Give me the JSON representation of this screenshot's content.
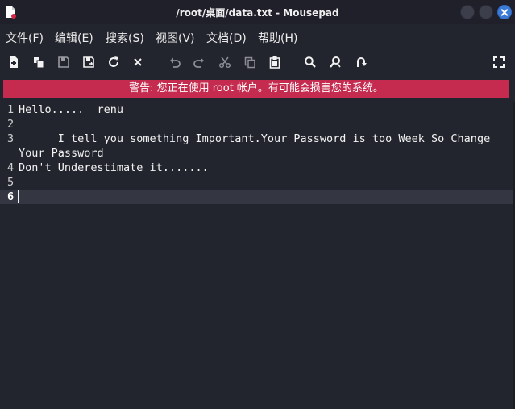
{
  "window": {
    "title": "/root/桌面/data.txt - Mousepad"
  },
  "menu": [
    {
      "id": "file",
      "label": "文件(F)"
    },
    {
      "id": "edit",
      "label": "编辑(E)"
    },
    {
      "id": "search",
      "label": "搜索(S)"
    },
    {
      "id": "view",
      "label": "视图(V)"
    },
    {
      "id": "document",
      "label": "文档(D)"
    },
    {
      "id": "help",
      "label": "帮助(H)"
    }
  ],
  "toolbar": [
    "new-document-icon",
    "new-window-icon",
    "save-icon",
    "save-as-icon",
    "reload-icon",
    "close-icon",
    "undo-icon",
    "redo-icon",
    "cut-icon",
    "copy-icon",
    "paste-icon",
    "find-icon",
    "find-replace-icon",
    "go-to-line-icon",
    "fullscreen-icon"
  ],
  "warning": "警告: 您正在使用 root 帐户。有可能会损害您的系统。",
  "editor": {
    "lines": [
      {
        "number": "1",
        "text": "Hello.....  renu"
      },
      {
        "number": "2",
        "text": ""
      },
      {
        "number": "3",
        "text": "      I tell you something Important.Your Password is too Week So Change",
        "wrap": "Your Password"
      },
      {
        "number": "4",
        "text": "Don't Underestimate it......."
      },
      {
        "number": "5",
        "text": ""
      },
      {
        "number": "6",
        "text": ""
      }
    ],
    "current_line": "6"
  },
  "colors": {
    "background": "#23252e",
    "warning_bar": "#c42b4f",
    "close_button": "#3a7bd5",
    "current_line": "#343641"
  }
}
